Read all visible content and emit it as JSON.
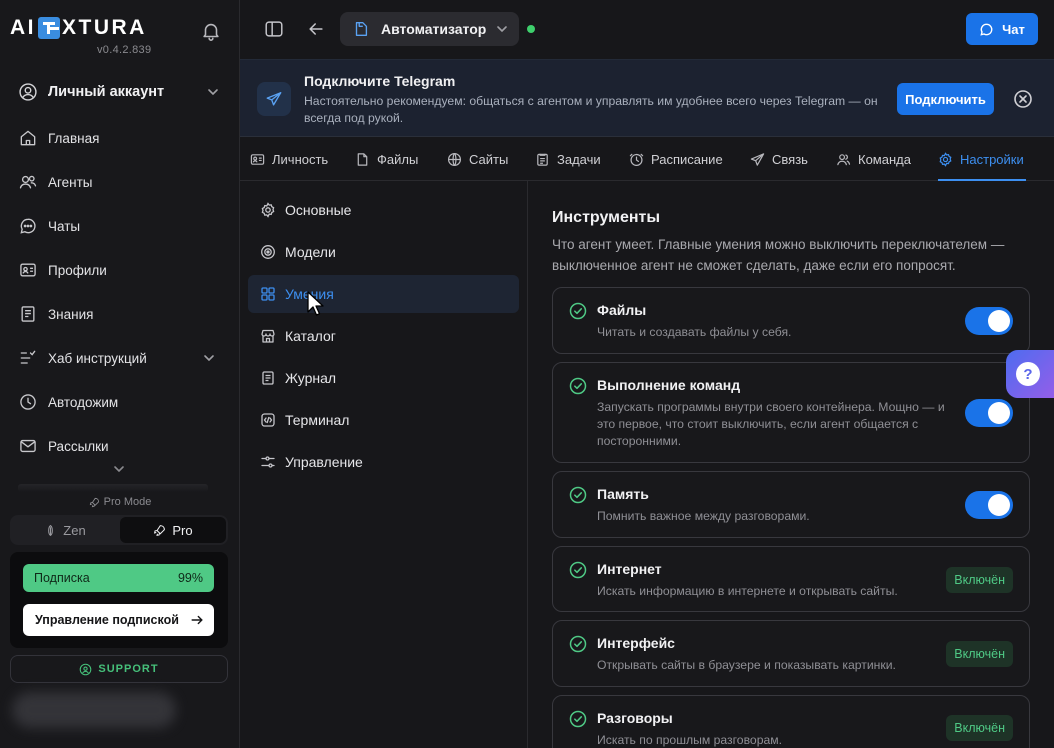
{
  "sidebar": {
    "logo_left": "AI",
    "logo_right": "XTURA",
    "version": "v0.4.2.839",
    "account_label": "Личный аккаунт",
    "items": [
      {
        "label": "Главная",
        "icon": "home-icon"
      },
      {
        "label": "Агенты",
        "icon": "users-icon"
      },
      {
        "label": "Чаты",
        "icon": "chat-bubble-icon"
      },
      {
        "label": "Профили",
        "icon": "id-card-icon"
      },
      {
        "label": "Знания",
        "icon": "book-icon"
      },
      {
        "label": "Хаб инструкций",
        "icon": "hub-icon"
      },
      {
        "label": "Автодожим",
        "icon": "clock-icon"
      },
      {
        "label": "Рассылки",
        "icon": "mail-icon"
      }
    ],
    "pro_mode_label": "Pro Mode",
    "mode_zen": "Zen",
    "mode_pro": "Pro",
    "subscription_label": "Подписка",
    "subscription_percent": "99%",
    "subscription_progress": 0.99,
    "manage_subscription": "Управление подпиской",
    "support": "SUPPORT"
  },
  "topbar": {
    "agent_name": "Автоматизатор",
    "chat_button": "Чат",
    "status": "online"
  },
  "banner": {
    "title": "Подключите Telegram",
    "text": "Настоятельно рекомендуем: общаться с агентом и управлять им удобнее всего через Telegram — он всегда под рукой.",
    "connect_button": "Подключить"
  },
  "tabs": [
    {
      "label": "Личность",
      "icon": "persona-icon"
    },
    {
      "label": "Файлы",
      "icon": "file-icon"
    },
    {
      "label": "Сайты",
      "icon": "globe-icon"
    },
    {
      "label": "Задачи",
      "icon": "tasks-icon"
    },
    {
      "label": "Расписание",
      "icon": "clock-icon"
    },
    {
      "label": "Связь",
      "icon": "send-icon"
    },
    {
      "label": "Команда",
      "icon": "team-icon"
    },
    {
      "label": "Настройки",
      "icon": "gear-icon",
      "active": true
    }
  ],
  "settings_nav": [
    {
      "label": "Основные",
      "icon": "gear-icon"
    },
    {
      "label": "Модели",
      "icon": "model-icon"
    },
    {
      "label": "Умения",
      "icon": "grid-icon",
      "active": true
    },
    {
      "label": "Каталог",
      "icon": "store-icon"
    },
    {
      "label": "Журнал",
      "icon": "journal-icon"
    },
    {
      "label": "Терминал",
      "icon": "terminal-icon"
    },
    {
      "label": "Управление",
      "icon": "sliders-icon"
    }
  ],
  "content": {
    "title": "Инструменты",
    "description": "Что агент умеет. Главные умения можно выключить переключателем — выключенное агент не сможет сделать, даже если его попросят.",
    "tools": [
      {
        "name": "Файлы",
        "description": "Читать и создавать файлы у себя.",
        "control": "toggle",
        "enabled": true
      },
      {
        "name": "Выполнение команд",
        "description": "Запускать программы внутри своего контейнера. Мощно — и это первое, что стоит выключить, если агент общается с посторонними.",
        "control": "toggle",
        "enabled": true
      },
      {
        "name": "Память",
        "description": "Помнить важное между разговорами.",
        "control": "toggle",
        "enabled": true
      },
      {
        "name": "Интернет",
        "description": "Искать информацию в интернете и открывать сайты.",
        "control": "badge",
        "badge": "Включён"
      },
      {
        "name": "Интерфейс",
        "description": "Открывать сайты в браузере и показывать картинки.",
        "control": "badge",
        "badge": "Включён"
      },
      {
        "name": "Разговоры",
        "description": "Искать по прошлым разговорам.",
        "control": "badge",
        "badge": "Включён"
      }
    ]
  },
  "help_button": "?",
  "colors": {
    "accent": "#1a73e8",
    "active_text": "#3d8ff0",
    "success": "#4fc985",
    "background": "#17171a"
  }
}
